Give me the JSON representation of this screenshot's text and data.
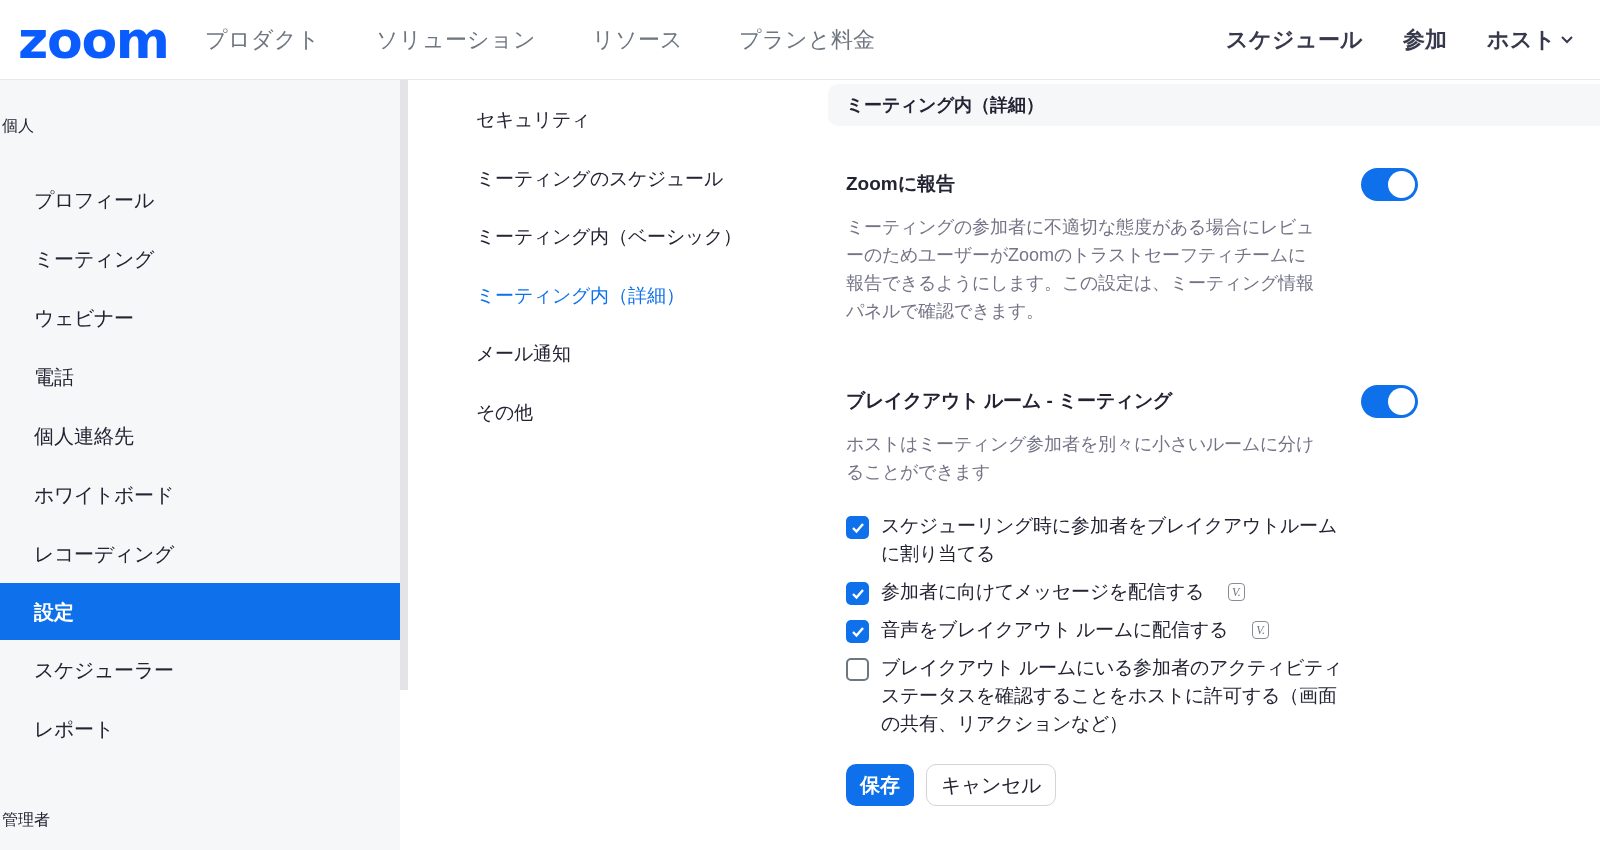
{
  "header": {
    "logo": "zoom",
    "nav": [
      "プロダクト",
      "ソリューション",
      "リソース",
      "プランと料金"
    ],
    "actions": [
      {
        "label": "スケジュール",
        "dropdown": false
      },
      {
        "label": "参加",
        "dropdown": false
      },
      {
        "label": "ホスト",
        "dropdown": true
      }
    ]
  },
  "sidebar": {
    "sections": [
      {
        "title": "個人",
        "items": [
          {
            "label": "プロフィール",
            "selected": false
          },
          {
            "label": "ミーティング",
            "selected": false
          },
          {
            "label": "ウェビナー",
            "selected": false
          },
          {
            "label": "電話",
            "selected": false
          },
          {
            "label": "個人連絡先",
            "selected": false
          },
          {
            "label": "ホワイトボード",
            "selected": false
          },
          {
            "label": "レコーディング",
            "selected": false
          },
          {
            "label": "設定",
            "selected": true
          },
          {
            "label": "スケジューラー",
            "selected": false
          },
          {
            "label": "レポート",
            "selected": false
          }
        ]
      },
      {
        "title": "管理者"
      }
    ]
  },
  "subnav": [
    {
      "label": "セキュリティ",
      "selected": false
    },
    {
      "label": "ミーティングのスケジュール",
      "selected": false
    },
    {
      "label": "ミーティング内（ベーシック）",
      "selected": false
    },
    {
      "label": "ミーティング内（詳細）",
      "selected": true
    },
    {
      "label": "メール通知",
      "selected": false
    },
    {
      "label": "その他",
      "selected": false
    }
  ],
  "section_title": "ミーティング内（詳細）",
  "settings": [
    {
      "title": "Zoomに報告",
      "on": true,
      "description": "ミーティングの参加者に不適切な態度がある場合にレビューのためユーザーがZoomのトラストセーフティチームに報告できるようにします。この設定は、ミーティング情報パネルで確認できます。"
    },
    {
      "title": "ブレイクアウト ルーム - ミーティング",
      "on": true,
      "description": "ホストはミーティング参加者を別々に小さいルームに分けることができます",
      "options": [
        {
          "label": "スケジューリング時に参加者をブレイクアウトルームに割り当てる",
          "checked": true
        },
        {
          "label": "参加者に向けてメッセージを配信する",
          "checked": true,
          "badge": "V."
        },
        {
          "label": "音声をブレイクアウト ルームに配信する",
          "checked": true,
          "badge": "V."
        },
        {
          "label": "ブレイクアウト ルームにいる参加者のアクティビティステータスを確認することをホストに許可する（画面の共有、リアクションなど）",
          "checked": false
        }
      ]
    }
  ],
  "buttons": {
    "save": "保存",
    "cancel": "キャンセル"
  }
}
